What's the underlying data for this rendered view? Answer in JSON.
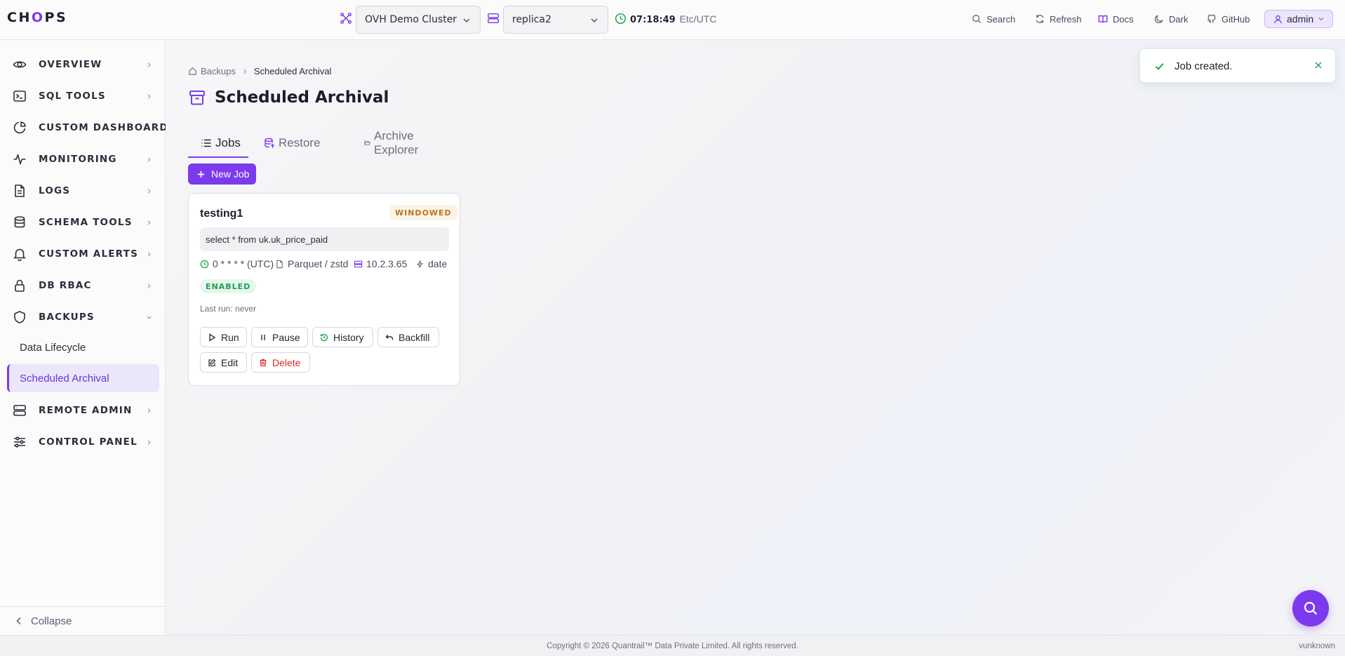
{
  "header": {
    "logo_prefix": "CH",
    "logo_mark": "O",
    "logo_suffix": "PS",
    "cluster": "OVH Demo Cluster",
    "replica": "replica2",
    "clock_time": "07:18:49",
    "clock_tz": "Etc/UTC",
    "nav": {
      "search": "Search",
      "refresh": "Refresh",
      "docs": "Docs",
      "dark": "Dark",
      "github": "GitHub"
    },
    "user": "admin"
  },
  "sidebar": {
    "items": [
      {
        "label": "OVERVIEW",
        "icon": "eye-icon"
      },
      {
        "label": "SQL TOOLS",
        "icon": "terminal-icon"
      },
      {
        "label": "CUSTOM DASHBOARDS",
        "icon": "pie-chart-icon"
      },
      {
        "label": "MONITORING",
        "icon": "pulse-icon"
      },
      {
        "label": "LOGS",
        "icon": "file-icon"
      },
      {
        "label": "SCHEMA TOOLS",
        "icon": "database-icon"
      },
      {
        "label": "CUSTOM ALERTS",
        "icon": "bell-icon"
      },
      {
        "label": "DB RBAC",
        "icon": "lock-icon"
      },
      {
        "label": "BACKUPS",
        "icon": "shield-icon"
      },
      {
        "label": "REMOTE ADMIN",
        "icon": "server-icon"
      },
      {
        "label": "CONTROL PANEL",
        "icon": "sliders-icon"
      }
    ],
    "backups_sub": [
      "Data Lifecycle",
      "Scheduled Archival"
    ],
    "collapse": "Collapse"
  },
  "main": {
    "breadcrumb": {
      "parent": "Backups",
      "current": "Scheduled Archival"
    },
    "title": "Scheduled Archival",
    "tabs": [
      "Jobs",
      "Restore",
      "Archive Explorer"
    ],
    "new_job": "New Job",
    "job": {
      "name": "testing1",
      "mode": "WINDOWED",
      "query": "select * from uk.uk_price_paid",
      "schedule": "0 * * * * (UTC)",
      "format": "Parquet / zstd",
      "host": "10.2.3.65",
      "partition_column": "date",
      "status": "ENABLED",
      "last_run": "Last run: never",
      "actions": {
        "run": "Run",
        "pause": "Pause",
        "history": "History",
        "backfill": "Backfill",
        "edit": "Edit",
        "delete": "Delete"
      }
    }
  },
  "toast": {
    "message": "Job created."
  },
  "footer": {
    "copyright": "Copyright © 2026 Quantrail™ Data Private Limited. All rights reserved.",
    "version": "vunknown"
  },
  "colors": {
    "accent": "#7c3aed",
    "success": "#16a34a",
    "danger": "#dc2626",
    "warning": "#b7791f"
  }
}
